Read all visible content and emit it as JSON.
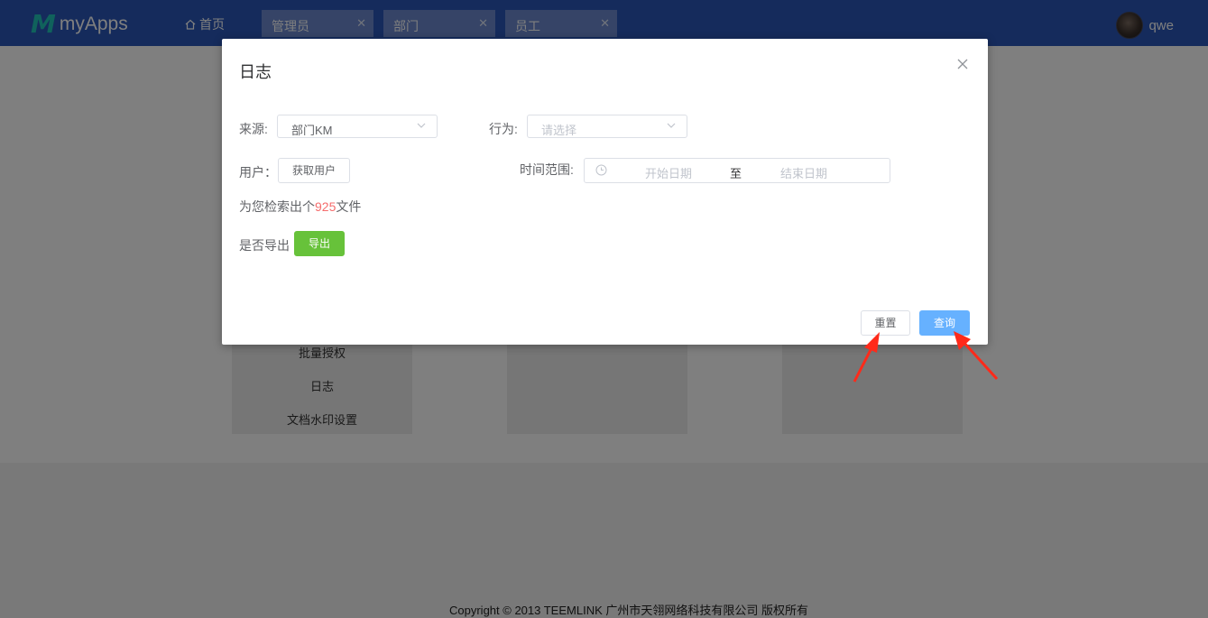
{
  "header": {
    "logo_text": "myApps",
    "home_label": "首页",
    "tabs": [
      {
        "label": "管理员"
      },
      {
        "label": "部门"
      },
      {
        "label": "员工"
      }
    ],
    "user_name": "qwe"
  },
  "background": {
    "menu_items": [
      "批量授权",
      "日志",
      "文档水印设置"
    ],
    "footer": "Copyright © 2013 TEEMLINK 广州市天翎网络科技有限公司 版权所有"
  },
  "dialog": {
    "title": "日志",
    "source_label": "来源:",
    "source_value": "部门KM",
    "action_label": "行为:",
    "action_placeholder": "请选择",
    "user_label": "用户：",
    "get_user_button": "获取用户",
    "time_range_label": "时间范围:",
    "start_date_placeholder": "开始日期",
    "range_separator": "至",
    "end_date_placeholder": "结束日期",
    "result_prefix": "为您检索出个",
    "result_count": "925",
    "result_suffix": "文件",
    "export_label": "是否导出",
    "export_button": "导出",
    "reset_button": "重置",
    "query_button": "查询"
  },
  "colors": {
    "header_bg": "#2b57b8",
    "tab_bg": "#6d89cf",
    "logo_accent": "#21c4b8",
    "export_green": "#67c23a",
    "query_blue": "#66b1ff",
    "count_red": "#f56c6c",
    "annotation_arrow": "#ff2a1a"
  }
}
